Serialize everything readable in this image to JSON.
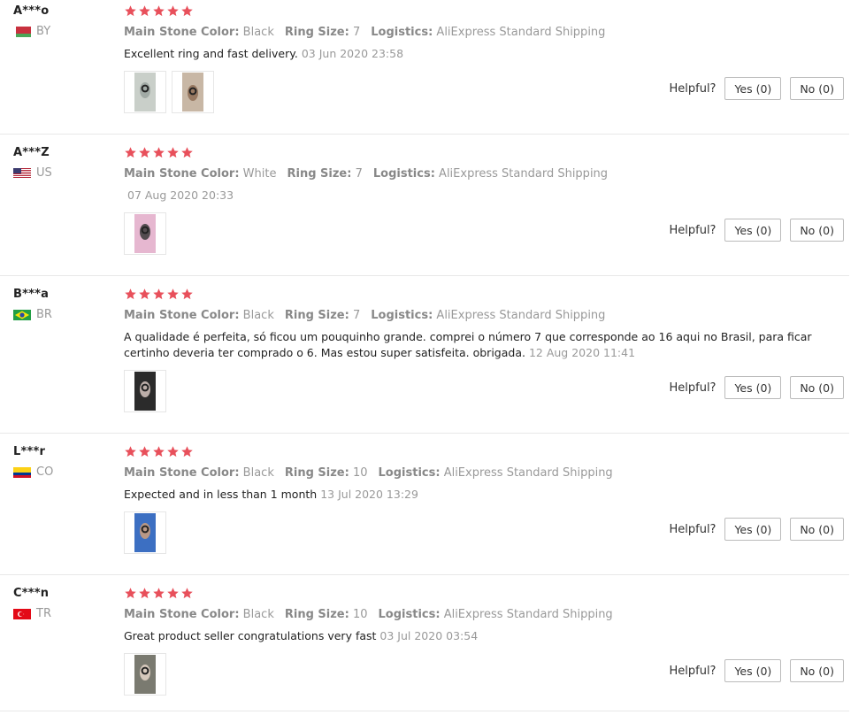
{
  "labels": {
    "main_stone_color": "Main Stone Color:",
    "ring_size": "Ring Size:",
    "logistics": "Logistics:",
    "helpful": "Helpful?"
  },
  "reviews": [
    {
      "user": "A***o",
      "country": "BY",
      "stars": 5,
      "stone_color": "Black",
      "ring_size": "7",
      "logistics": "AliExpress Standard Shipping",
      "text": "Excellent ring and fast delivery.",
      "date": "03 Jun 2020 23:58",
      "photos": [
        "ring-photo-1",
        "ring-photo-2"
      ],
      "yes": "Yes (0)",
      "no": "No (0)"
    },
    {
      "user": "A***Z",
      "country": "US",
      "stars": 5,
      "stone_color": "White",
      "ring_size": "7",
      "logistics": "AliExpress Standard Shipping",
      "text": "",
      "date": "07 Aug 2020 20:33",
      "photos": [
        "ring-photo-1"
      ],
      "yes": "Yes (0)",
      "no": "No (0)"
    },
    {
      "user": "B***a",
      "country": "BR",
      "stars": 5,
      "stone_color": "Black",
      "ring_size": "7",
      "logistics": "AliExpress Standard Shipping",
      "text": "A qualidade é perfeita, só ficou um pouquinho grande. comprei o número 7 que corresponde ao 16 aqui no Brasil, para ficar certinho deveria ter comprado o 6. Mas estou super satisfeita. obrigada.",
      "date": "12 Aug 2020 11:41",
      "photos": [
        "ring-photo-1"
      ],
      "yes": "Yes (0)",
      "no": "No (0)"
    },
    {
      "user": "L***r",
      "country": "CO",
      "stars": 5,
      "stone_color": "Black",
      "ring_size": "10",
      "logistics": "AliExpress Standard Shipping",
      "text": "Expected and in less than 1 month",
      "date": "13 Jul 2020 13:29",
      "photos": [
        "ring-photo-1"
      ],
      "yes": "Yes (0)",
      "no": "No (0)"
    },
    {
      "user": "C***n",
      "country": "TR",
      "stars": 5,
      "stone_color": "Black",
      "ring_size": "10",
      "logistics": "AliExpress Standard Shipping",
      "text": "Great product seller congratulations very fast",
      "date": "03 Jul 2020 03:54",
      "photos": [
        "ring-photo-1"
      ],
      "yes": "Yes (0)",
      "no": "No (0)"
    }
  ],
  "colors": {
    "star": "#e8505b",
    "muted": "#999999"
  }
}
